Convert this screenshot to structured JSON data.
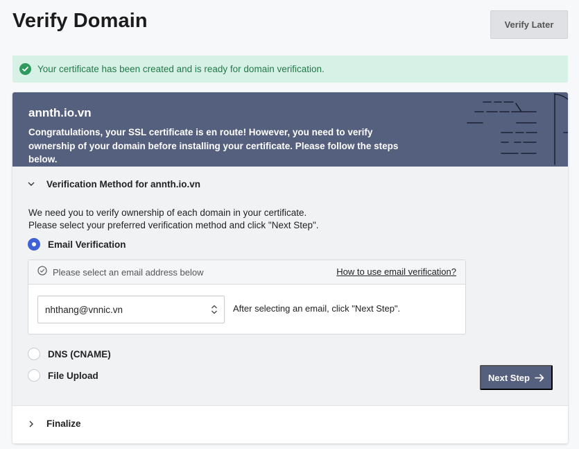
{
  "page": {
    "title": "Verify Domain",
    "verify_later_label": "Verify Later"
  },
  "alert": {
    "text": "Your certificate has been created and is ready for domain verification.",
    "color": "#2e9a5f"
  },
  "banner": {
    "domain": "annth.io.vn",
    "message": "Congratulations, your SSL certificate is en route! However, you need to verify ownership of your domain before installing your certificate. Please follow the steps below.",
    "color": "#555f7e"
  },
  "step1": {
    "title": "Verification Method for annth.io.vn",
    "instructions_line1": "We need you to verify ownership of each domain in your certificate.",
    "instructions_line2": "Please select your preferred verification method and click \"Next Step\".",
    "methods": [
      {
        "label": "Email Verification",
        "checked": true
      },
      {
        "label": "DNS (CNAME)",
        "checked": false
      },
      {
        "label": "File Upload",
        "checked": false
      }
    ],
    "email_box": {
      "hint": "Please select an email address below",
      "help_link": "How to use email verification?",
      "selected_email": "nhthang@vnnic.vn",
      "after_text": "After selecting an email, click \"Next Step\"."
    },
    "next_label": "Next Step"
  },
  "step2": {
    "title": "Finalize"
  }
}
